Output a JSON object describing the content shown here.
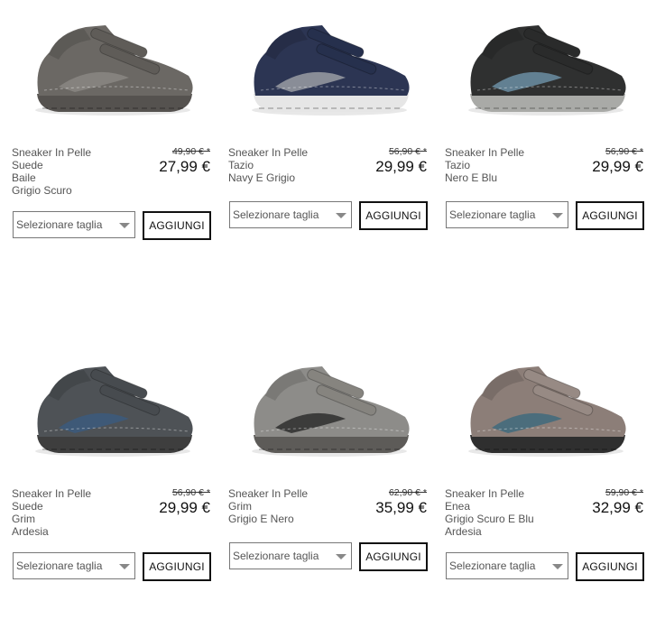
{
  "select_placeholder": "Selezionare taglia",
  "add_label": "AGGIUNGI",
  "products": [
    {
      "lines": [
        "Sneaker In Pelle",
        "Suede",
        "Baile",
        "Grigio Scuro"
      ],
      "old_price": "49,90 € *",
      "price": "27,99 €",
      "colors": {
        "upper": "#6b6864",
        "accent": "#8a8782",
        "sole": "#55524f",
        "strap": "#5f5c58"
      }
    },
    {
      "lines": [
        "Sneaker In Pelle",
        "Tazio",
        "Navy E Grigio"
      ],
      "old_price": "56,90 € *",
      "price": "29,99 €",
      "colors": {
        "upper": "#2c3553",
        "accent": "#9a9ca3",
        "sole": "#e6e6e6",
        "strap": "#26304d"
      }
    },
    {
      "lines": [
        "Sneaker In Pelle",
        "Tazio",
        "Nero E Blu"
      ],
      "old_price": "56,90 € *",
      "price": "29,99 €",
      "colors": {
        "upper": "#2f3030",
        "accent": "#6b8ea3",
        "sole": "#a9aaa7",
        "strap": "#2a2b2b"
      }
    },
    {
      "lines": [
        "Sneaker In Pelle",
        "Suede",
        "Grim",
        "Ardesia"
      ],
      "old_price": "56,90 € *",
      "price": "29,99 €",
      "colors": {
        "upper": "#4e5256",
        "accent": "#3c5a7d",
        "sole": "#3e3e3e",
        "strap": "#474b4f"
      }
    },
    {
      "lines": [
        "Sneaker In Pelle",
        "Grim",
        "Grigio E Nero"
      ],
      "old_price": "62,90 € *",
      "price": "35,99 €",
      "colors": {
        "upper": "#8d8c89",
        "accent": "#2e2e2e",
        "sole": "#5d5b58",
        "strap": "#86847f"
      }
    },
    {
      "lines": [
        "Sneaker In Pelle",
        "Enea",
        "Grigio Scuro E Blu",
        "Ardesia"
      ],
      "old_price": "59,90 € *",
      "price": "32,99 €",
      "colors": {
        "upper": "#8c7e78",
        "accent": "#3f6a7d",
        "sole": "#2f2f2f",
        "strap": "#978a84"
      }
    }
  ]
}
